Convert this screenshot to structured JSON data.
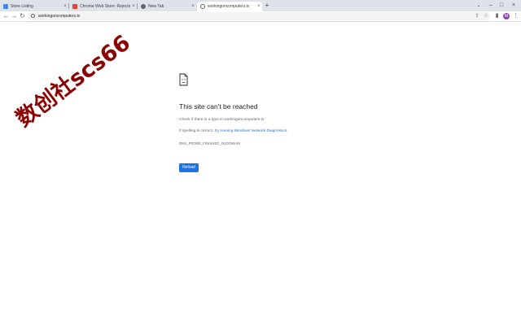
{
  "tabs": [
    {
      "title": "Store Listing",
      "close": "×",
      "active": false
    },
    {
      "title": "Chrome Web Store: Rejection e...",
      "close": "×",
      "active": false
    },
    {
      "title": "New Tab",
      "close": "×",
      "active": false
    },
    {
      "title": "workingoncomputers.tv",
      "close": "×",
      "active": true
    }
  ],
  "tabstrip": {
    "new_tab": "+",
    "tab_search": "⌄",
    "minimize": "–",
    "maximize": "□",
    "close": "×"
  },
  "toolbar": {
    "back": "←",
    "forward": "→",
    "reload": "↻",
    "url": "workingoncomputers.tv",
    "share": "⇪",
    "bookmark": "☆",
    "extensions": "▮",
    "profile_initial": "M",
    "menu": "⋮"
  },
  "error_page": {
    "title": "This site can't be reached",
    "check_text": "Check if there is a typo in workingoncomputers.tv",
    "spelling_prefix": "If spelling is correct, ",
    "spelling_link": "try running Windows Network Diagnostics",
    "spelling_suffix": ".",
    "error_code": "DNS_PROBE_FINISHED_NXDOMAIN",
    "reload_label": "Reload"
  },
  "watermark": {
    "text": "数创社scs66"
  },
  "colors": {
    "accent": "#1a73e8",
    "tabstrip": "#dee3ea",
    "watermark": "#8b0000"
  }
}
